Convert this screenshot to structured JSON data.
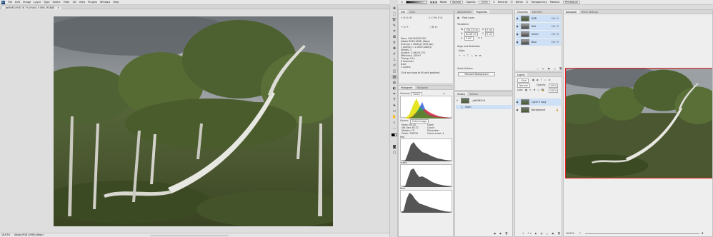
{
  "menubar": {
    "app_badge": "Ps",
    "items": [
      "File",
      "Edit",
      "Image",
      "Layer",
      "Type",
      "Select",
      "Filter",
      "3D",
      "View",
      "Plugins",
      "Window",
      "Help"
    ]
  },
  "document": {
    "tab_title": "_dsf4983.tif @ 16.7% (Hue/1.0 56%, RGB/8)",
    "status_zoom": "16.67%",
    "status_info": "Adobe RGB (1998) (8bpc)"
  },
  "options": {
    "mode_label": "Mode:",
    "mode_value": "Normal",
    "opacity_label": "Opacity:",
    "opacity_value": "100%",
    "reverse": "Reverse",
    "dither": "Dither",
    "transparency": "Transparency",
    "method_label": "Method:",
    "method_value": "Perceptual"
  },
  "info_panel": {
    "tabs": [
      "Info",
      "Color"
    ],
    "readout": [
      "Docs: 146.0M/292.0M",
      "Adobe RGB (1998) (8bpc)",
      "6144 px x 4096 px (300 ppi)",
      "1 pixel(s) = 1.0000 pixel(s)",
      "Sheets: 1",
      "Scratch: 2.49G/9.27G",
      "Efficiency: 100%*",
      "Timing: 0.1s",
      "8 Channels",
      "8-bit",
      "2 Layers"
    ],
    "hint": "Click and drag to fill with gradient."
  },
  "histogram": {
    "tabs": [
      "Histogram",
      "Navigator"
    ],
    "channel_label": "Channel:",
    "channel_value": "Colors",
    "source_label": "Source:",
    "source_value": "Entire Image",
    "stats": [
      "Mean: 85.20",
      "Std Dev: 58.72",
      "Median: 79",
      "Pixels: 798720",
      "Level:",
      "Count:",
      "Percentile:",
      "Cache Level: 4"
    ],
    "channel_names": [
      "Red",
      "Green",
      "Blue"
    ]
  },
  "properties": {
    "tabs": [
      "Adjustments",
      "Properties"
    ],
    "layer_kind": "Pixel Layer",
    "transform_title": "Transform",
    "w_value": "109.23 cm",
    "h_value": "81.06 cm",
    "x_value": "0 cm",
    "y_value": "0 cm",
    "angle_value": "0.00°",
    "align_title": "Align and Distribute",
    "align_label": "Align:",
    "quick_title": "Quick Actions",
    "remove_bg": "Remove Background"
  },
  "history": {
    "tabs": [
      "History",
      "Actions"
    ],
    "items": [
      "_dsf4983.tif",
      "Open"
    ]
  },
  "channels": {
    "tabs": [
      "Channels",
      "Libraries"
    ],
    "rows": [
      {
        "name": "RGB",
        "shortcut": "Ctrl+2"
      },
      {
        "name": "Red",
        "shortcut": "Ctrl+3"
      },
      {
        "name": "Green",
        "shortcut": "Ctrl+4"
      },
      {
        "name": "Blue",
        "shortcut": "Ctrl+5"
      }
    ]
  },
  "layers": {
    "tabs": [
      "Layers"
    ],
    "kind_label": "Kind",
    "blend_value": "Normal",
    "opacity_label": "Opacity:",
    "opacity_value": "100%",
    "lock_label": "Lock:",
    "fill_label": "Fill:",
    "fill_value": "100%",
    "rows": [
      "Layer 0 copy",
      "Background"
    ]
  },
  "navigator": {
    "tabs": [
      "Navigator",
      "Brush Settings"
    ]
  },
  "colors": {
    "accent": "#1473e6",
    "selection": "#cde0f5",
    "proxy_border": "#e0201e"
  }
}
